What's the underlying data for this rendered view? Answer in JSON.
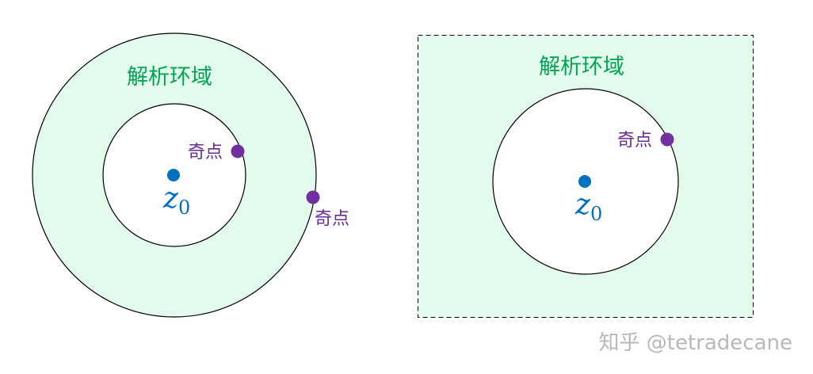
{
  "diagram": {
    "left_panel": {
      "region_label": "解析环域",
      "inner_singularity_label": "奇点",
      "outer_singularity_label": "奇点",
      "center_var": "z",
      "center_sub": "0"
    },
    "right_panel": {
      "region_label": "解析环域",
      "singularity_label": "奇点",
      "center_var": "z",
      "center_sub": "0"
    },
    "colors": {
      "annulus_fill": "#e3fbed",
      "outline": "#000000",
      "region_label": "#00a651",
      "singularity": "#7030a0",
      "singularity_label": "#6a2c91",
      "center": "#0070c0"
    }
  },
  "watermark": "知乎 @tetradecane"
}
